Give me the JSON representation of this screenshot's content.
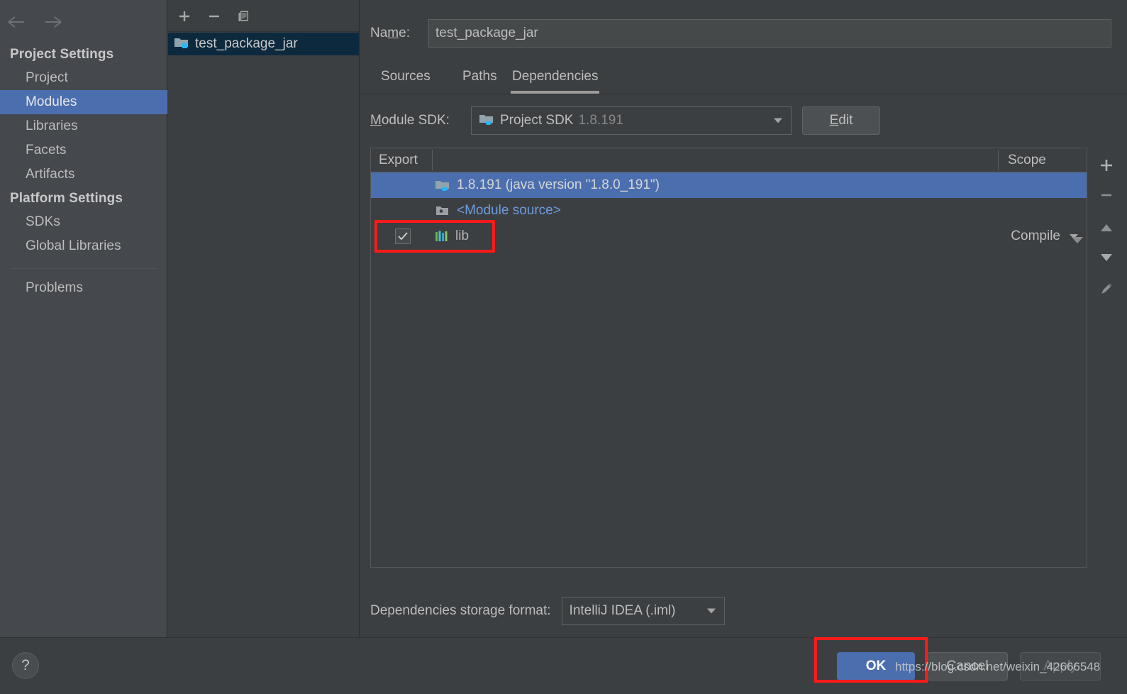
{
  "sidebar": {
    "nav": {
      "back_icon": "arrow-left-icon",
      "forward_icon": "arrow-right-icon"
    },
    "groups": [
      {
        "title": "Project Settings",
        "items": [
          {
            "label": "Project",
            "selected": false
          },
          {
            "label": "Modules",
            "selected": true
          },
          {
            "label": "Libraries",
            "selected": false
          },
          {
            "label": "Facets",
            "selected": false
          },
          {
            "label": "Artifacts",
            "selected": false
          }
        ]
      },
      {
        "title": "Platform Settings",
        "items": [
          {
            "label": "SDKs",
            "selected": false
          },
          {
            "label": "Global Libraries",
            "selected": false
          }
        ]
      }
    ],
    "problems": "Problems"
  },
  "module_list": {
    "toolbar": {
      "add": "+",
      "remove": "−",
      "copy_icon": "copy-icon"
    },
    "items": [
      {
        "label": "test_package_jar",
        "icon": "module-folder-icon",
        "selected": true
      }
    ]
  },
  "detail": {
    "name_label": "Name:",
    "name_value": "test_package_jar",
    "tabs": [
      {
        "label": "Sources",
        "active": false
      },
      {
        "label": "Paths",
        "active": false
      },
      {
        "label": "Dependencies",
        "active": true
      }
    ],
    "module_sdk": {
      "label": "Module SDK:",
      "value": "Project SDK",
      "version": "1.8.191",
      "edit_label": "Edit"
    },
    "table": {
      "columns": [
        "Export",
        "Scope"
      ],
      "rows": [
        {
          "export": null,
          "icon": "jdk-folder-icon",
          "name": "1.8.191 (java version \"1.8.0_191\")",
          "scope": "",
          "selected": true
        },
        {
          "export": null,
          "icon": "module-source-icon",
          "name": "<Module source>",
          "scope": "",
          "selected": false
        },
        {
          "export": true,
          "icon": "library-bars-icon",
          "name": "lib",
          "scope": "Compile",
          "selected": false
        }
      ]
    },
    "tools": {
      "add": "+",
      "remove": "−",
      "move_up": "move-up-icon",
      "move_down": "move-down-icon",
      "edit": "pencil-icon"
    },
    "storage": {
      "label": "Dependencies storage format:",
      "value": "IntelliJ IDEA (.iml)"
    }
  },
  "bottom": {
    "help": "?",
    "ok": "OK",
    "cancel": "Cancel",
    "apply": "Apply"
  },
  "watermark": "https://blog.csdn.net/weixin_42666548",
  "colors": {
    "selection_blue": "#4b6eaf",
    "tree_selection": "#0d293e",
    "link_blue": "#6c9ce0",
    "annotation_red": "#ff1a1a",
    "background": "#3c3f41",
    "sidebar_background": "#45484d"
  }
}
